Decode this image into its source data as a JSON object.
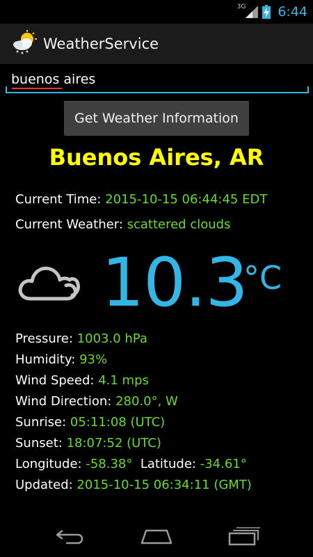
{
  "status_bar": {
    "network_label": "3G",
    "time": "6:44",
    "icons": [
      "signal-icon",
      "battery-charging-icon"
    ]
  },
  "action_bar": {
    "title": "WeatherService",
    "icon": "partly-cloudy-snow-icon"
  },
  "search": {
    "value": "buenos aires",
    "placeholder": ""
  },
  "button": {
    "label": "Get Weather Information"
  },
  "city": "Buenos Aires, AR",
  "current_time": {
    "label": "Current Time:",
    "value": "2015-10-15 06:44:45 EDT"
  },
  "current_weather": {
    "label": "Current Weather:",
    "value": "scattered clouds"
  },
  "temperature": {
    "value": "10.3",
    "unit": "°C",
    "icon": "cloud-icon"
  },
  "details": {
    "pressure": {
      "label": "Pressure:",
      "value": "1003.0 hPa"
    },
    "humidity": {
      "label": "Humidity:",
      "value": "93%"
    },
    "wind_speed": {
      "label": "Wind Speed:",
      "value": "4.1 mps"
    },
    "wind_direction": {
      "label": "Wind Direction:",
      "value": "280.0°, W"
    },
    "sunrise": {
      "label": "Sunrise:",
      "value": "05:11:08 (UTC)"
    },
    "sunset": {
      "label": "Sunset:",
      "value": "18:07:52 (UTC)"
    },
    "longitude": {
      "label": "Longitude:",
      "value": "-58.38°"
    },
    "latitude": {
      "label": "Latitude:",
      "value": "-34.61°"
    },
    "updated": {
      "label": "Updated:",
      "value": "2015-10-15 06:34:11 (GMT)"
    }
  },
  "nav": {
    "icons": [
      "back-icon",
      "home-icon",
      "recents-icon"
    ]
  },
  "colors": {
    "accent": "#33b5e5",
    "city": "#ffff00",
    "value": "#66dd22",
    "background": "#000000"
  }
}
